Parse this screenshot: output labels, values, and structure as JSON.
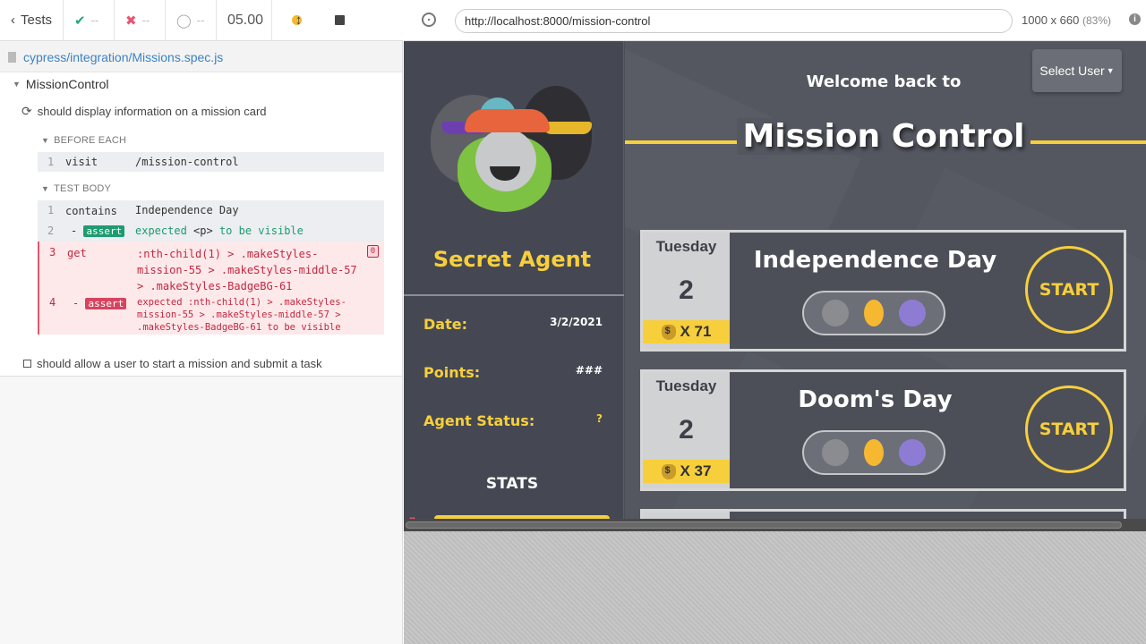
{
  "runner": {
    "tests_label": "Tests",
    "passed": "--",
    "failed": "--",
    "pending": "--",
    "duration": "05.00",
    "spec_file": "cypress/integration/Missions.spec.js",
    "suite_name": "MissionControl",
    "test1_title": "should display information on a mission card",
    "before_each_label": "BEFORE EACH",
    "test_body_label": "TEST BODY",
    "before_cmd": {
      "num": "1",
      "name": "visit",
      "msg": "/mission-control"
    },
    "body_cmds": [
      {
        "num": "1",
        "name": "contains",
        "msg": "Independence Day"
      },
      {
        "num": "2",
        "name": "assert",
        "msg_a": "expected ",
        "msg_b": "<p>",
        "msg_c": " to be ",
        "msg_d": "visible"
      },
      {
        "num": "3",
        "name": "get",
        "line1": ":nth-child(1) > .makeStyles-",
        "line2": "mission-55 > .makeStyles-middle-57",
        "line3": "> .makeStyles-BadgeBG-61",
        "pin": "0"
      },
      {
        "num": "4",
        "name": "assert",
        "line1": "expected  :nth-child(1) > .makeStyles-",
        "line2": "mission-55 > .makeStyles-middle-57 >",
        "line3": ".makeStyles-BadgeBG-61  to be  visible"
      }
    ],
    "test2_title": "should allow a user to start a mission and submit a task"
  },
  "browser": {
    "url": "http://localhost:8000/mission-control",
    "viewport": "1000 x 660",
    "scale": "(83%)",
    "info_icon": "i"
  },
  "app": {
    "agent_title": "Secret Agent",
    "date_label": "Date:",
    "date_value": "3/2/2021",
    "points_label": "Points:",
    "points_value": "###",
    "status_label": "Agent Status:",
    "status_value": "?",
    "stats_label": "STATS",
    "select_user": "Select User",
    "welcome": "Welcome back to",
    "title": "Mission Control",
    "missions": [
      {
        "day": "Tuesday",
        "date": "2",
        "coins": "X 71",
        "title": "Independence Day",
        "action": "START"
      },
      {
        "day": "Tuesday",
        "date": "2",
        "coins": "X 37",
        "title": "Doom's Day",
        "action": "START"
      }
    ]
  },
  "colors": {
    "accent": "#f7cf3c",
    "pass": "#25a57f",
    "fail": "#e45770",
    "app_bg": "#4b4e56"
  }
}
